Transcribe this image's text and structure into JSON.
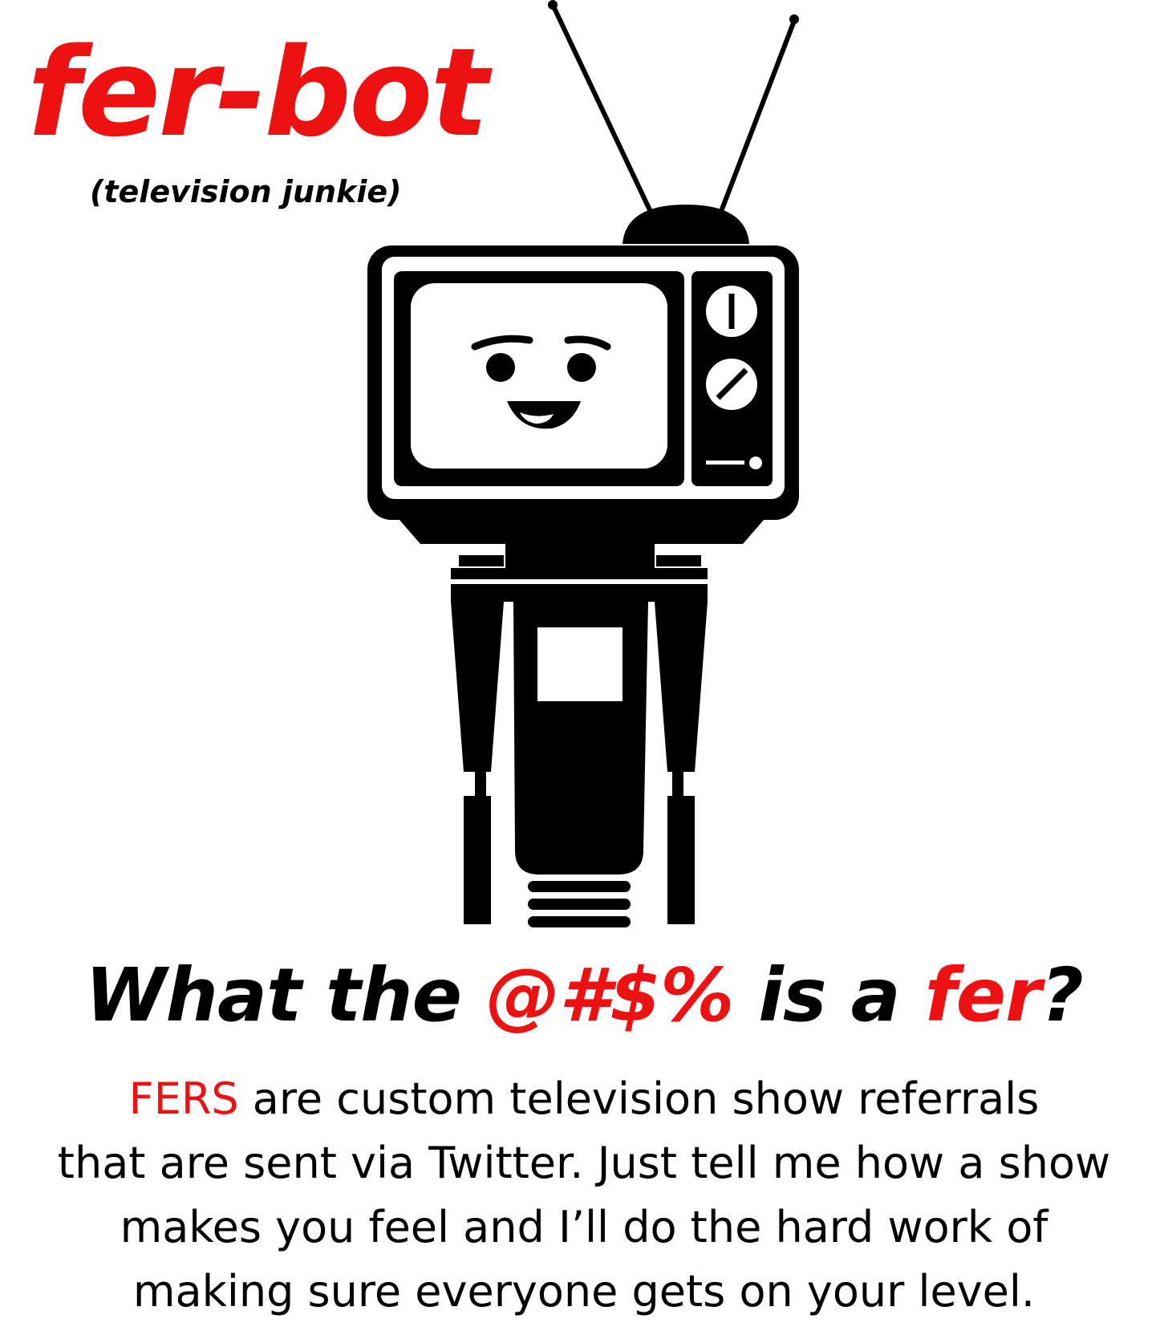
{
  "brand": {
    "title": "fer-bot",
    "subtitle": "(television junkie)"
  },
  "headline": {
    "part1": "What the ",
    "symbols": "@#$%",
    "part2": " is a ",
    "fer": "fer",
    "question": "?"
  },
  "description": {
    "fers": "FERS",
    "line1_rest": " are custom television show referrals",
    "line2": "that are sent via Twitter. Just tell me how a show",
    "line3": "makes you feel and I’ll do the hard work of",
    "line4": "making sure everyone gets on your level."
  },
  "colors": {
    "accent": "#ee1111",
    "ink": "#000000",
    "background": "#ffffff"
  },
  "icons": {
    "mascot": "tv-head-robot-icon"
  }
}
